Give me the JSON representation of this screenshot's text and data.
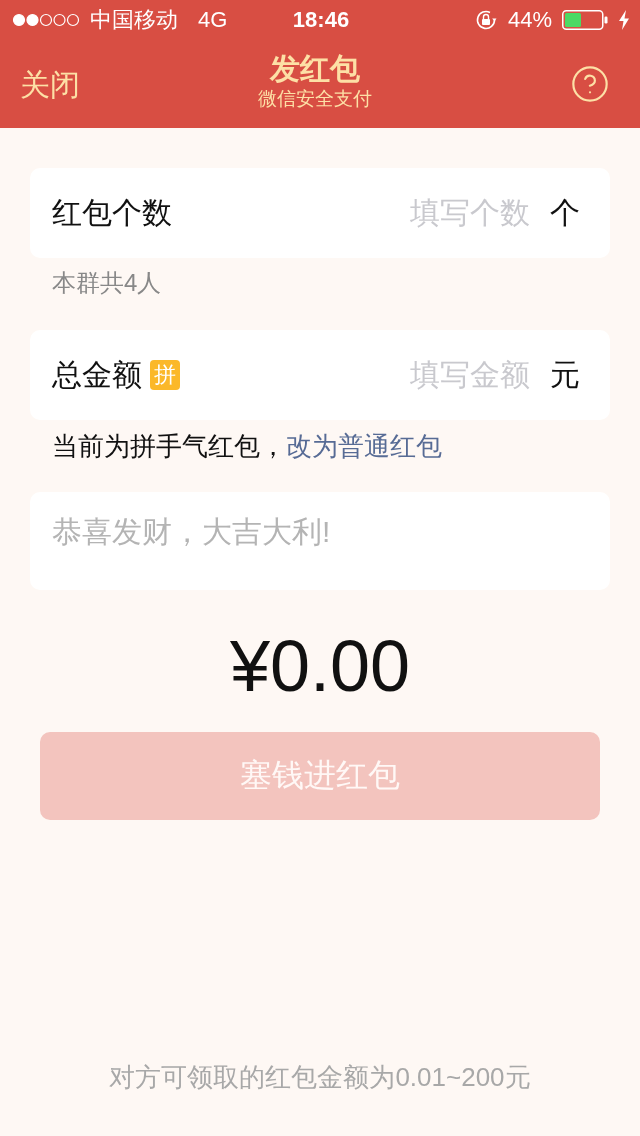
{
  "status_bar": {
    "carrier": "中国移动",
    "network": "4G",
    "time": "18:46",
    "battery": "44%",
    "charging": true
  },
  "nav_bar": {
    "close": "关闭",
    "title": "发红包",
    "subtitle": "微信安全支付"
  },
  "form": [
    {
      "kind": "field",
      "label": "红包个数",
      "placeholder": "填写个数",
      "unit": "个"
    },
    {
      "kind": "hint",
      "text": "本群共4人"
    },
    {
      "kind": "field",
      "label": "总金额",
      "badge": "拼",
      "placeholder": "填写金额",
      "unit": "元"
    },
    {
      "kind": "mode",
      "text": "当前为拼手气红包，",
      "link": "改为普通红包"
    },
    {
      "kind": "message",
      "placeholder": "恭喜发财，大吉大利!"
    }
  ],
  "total": "¥0.00",
  "submit": {
    "label": "塞钱进红包",
    "disabled": true
  },
  "footer": "对方可领取的红包金额为0.01~200元"
}
